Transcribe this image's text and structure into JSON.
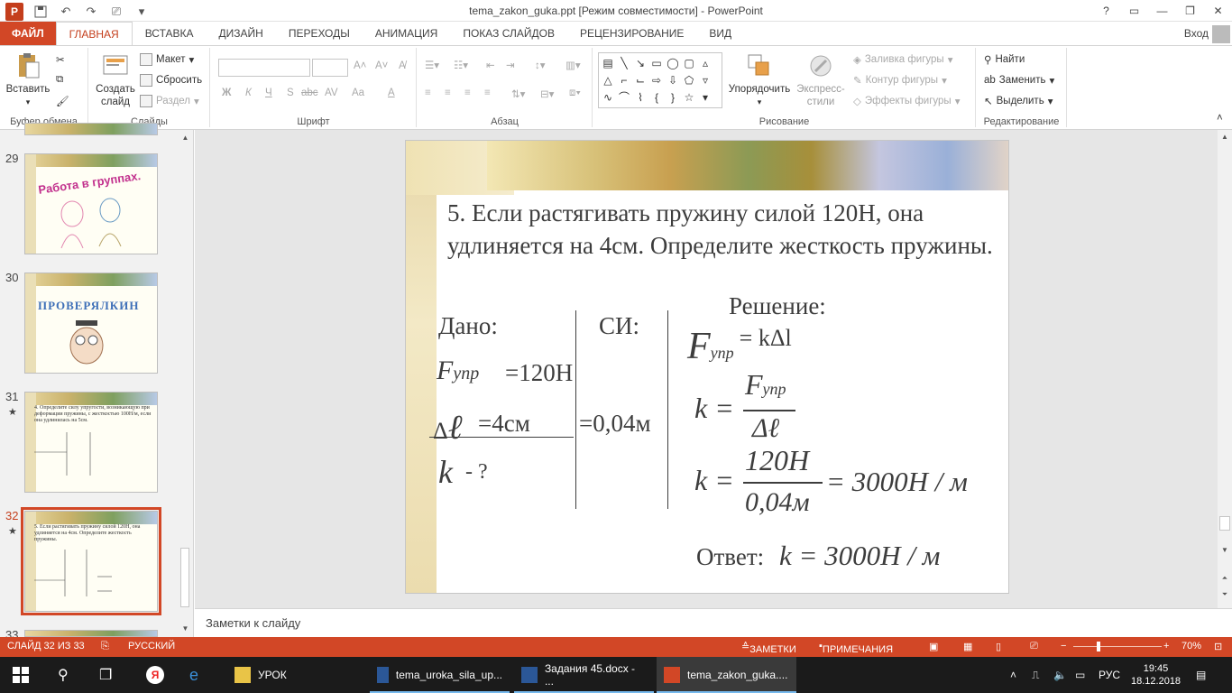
{
  "window": {
    "title": "tema_zakon_guka.ppt [Режим совместимости] - PowerPoint",
    "help": "?",
    "app_icon": "P"
  },
  "tabs": [
    "ФАЙЛ",
    "ГЛАВНАЯ",
    "ВСТАВКА",
    "ДИЗАЙН",
    "ПЕРЕХОДЫ",
    "АНИМАЦИЯ",
    "ПОКАЗ СЛАЙДОВ",
    "РЕЦЕНЗИРОВАНИЕ",
    "ВИД"
  ],
  "signin": "Вход",
  "ribbon": {
    "clipboard": {
      "paste": "Вставить",
      "label": "Буфер обмена"
    },
    "slides": {
      "new_slide": "Создать слайд",
      "layout": "Макет",
      "reset": "Сбросить",
      "section": "Раздел",
      "label": "Слайды"
    },
    "font": {
      "label": "Шрифт",
      "bold": "Ж",
      "italic": "К",
      "underline": "Ч",
      "strike": "S",
      "abc": "abc",
      "spacing": "AV",
      "case": "Aa",
      "color": "A"
    },
    "paragraph": {
      "label": "Абзац"
    },
    "drawing": {
      "arrange": "Упорядочить",
      "quick_styles": "Экспресс-стили",
      "fill": "Заливка фигуры",
      "outline": "Контур фигуры",
      "effects": "Эффекты фигуры",
      "label": "Рисование"
    },
    "editing": {
      "find": "Найти",
      "replace": "Заменить",
      "select": "Выделить",
      "label": "Редактирование"
    }
  },
  "thumbnails": [
    {
      "num": "29",
      "title": "Работа в группах.",
      "star": ""
    },
    {
      "num": "30",
      "title": "ПРОВЕРЯЛКИН",
      "star": ""
    },
    {
      "num": "31",
      "title": "4. Определите силу упругости, возникающую при деформации пружины, с жесткостью 100Н/м, если она удлинилась на 5см.",
      "star": "★"
    },
    {
      "num": "32",
      "title": "5. Если растягивать пружину силой 120Н, она удлиняется на 4см. Определите жесткость пружины.",
      "star": "★"
    },
    {
      "num": "33",
      "title": "",
      "star": ""
    }
  ],
  "slide": {
    "problem": "5. Если растягивать пружину силой 120Н, она удлиняется на 4см. Определите жесткость пружины.",
    "dano": "Дано:",
    "si": "СИ:",
    "solution": "Решение:",
    "f_letter": "F",
    "f_sub": "упр",
    "f_value": "=120Н",
    "dl_delta": "Δ",
    "dl_letter": "ℓ",
    "dl_value": "=4см",
    "si_value": "=0,04м",
    "k_letter": "k",
    "k_question": "- ?",
    "eq1_rhs": "= kΔl",
    "eq2_lhs": "k =",
    "eq2_den": "Δℓ",
    "eq3_lhs": "k =",
    "eq3_num": "120H",
    "eq3_den": "0,04м",
    "eq3_rhs": "= 3000H / м",
    "answer_label": "Ответ:",
    "answer_value": "k = 3000H / м"
  },
  "notes_placeholder": "Заметки к слайду",
  "status": {
    "slide_counter": "СЛАЙД 32 ИЗ 33",
    "language": "РУССКИЙ",
    "notes": "ЗАМЕТКИ",
    "comments": "ПРИМЕЧАНИЯ",
    "zoom": "70%"
  },
  "taskbar": {
    "items": [
      "УРОК",
      "tema_uroka_sila_up...",
      "Задания 45.docx - ...",
      "tema_zakon_guka...."
    ],
    "lang": "РУС",
    "time": "19:45",
    "date": "18.12.2018"
  }
}
